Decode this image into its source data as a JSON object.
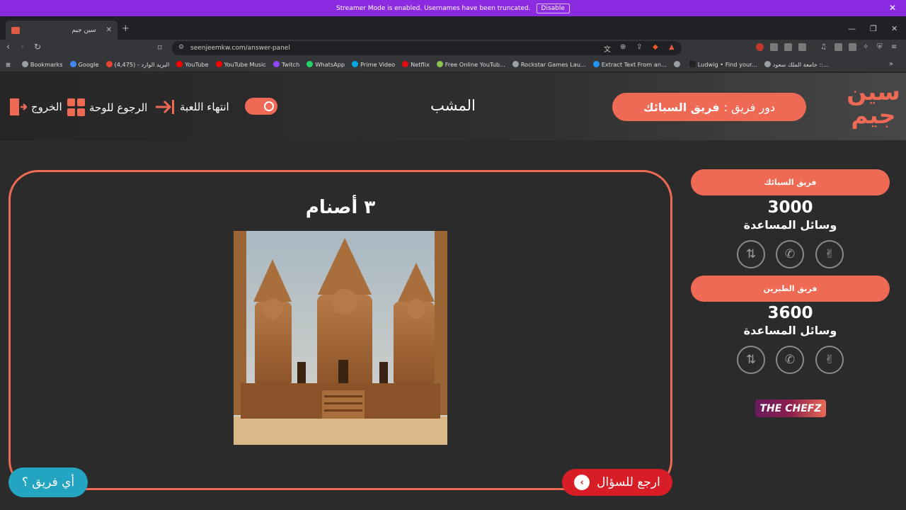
{
  "banner": {
    "message": "Streamer Mode is enabled. Usernames have been truncated.",
    "disable_label": "Disable"
  },
  "browser": {
    "tab_title": "سين جيم",
    "url": "seenjeemkw.com/answer-panel"
  },
  "bookmarks": [
    {
      "label": "Bookmarks",
      "color": "#9aa0a6"
    },
    {
      "label": "Google",
      "color": "#4285f4"
    },
    {
      "label": "البريد الوارد - (4,475)",
      "color": "#ea4335"
    },
    {
      "label": "YouTube",
      "color": "#ff0000"
    },
    {
      "label": "YouTube Music",
      "color": "#ff0000"
    },
    {
      "label": "Twitch",
      "color": "#9146ff"
    },
    {
      "label": "WhatsApp",
      "color": "#25d366"
    },
    {
      "label": "Prime Video",
      "color": "#00a8e1"
    },
    {
      "label": "Netflix",
      "color": "#e50914"
    },
    {
      "label": "Free Online YouTub...",
      "color": "#8bc34a"
    },
    {
      "label": "Rockstar Games Lau...",
      "color": "#9aa0a6"
    },
    {
      "label": "Extract Text From an...",
      "color": "#2196f3"
    },
    {
      "label": "",
      "color": "#9aa0a6"
    },
    {
      "label": "Ludwig • Find your...",
      "color": "#222222"
    },
    {
      "label": "جامعة الملك سعود ::...",
      "color": "#9aa0a6"
    }
  ],
  "header": {
    "exit_label": "الخروج",
    "board_label": "الرجوع للوحة",
    "end_game_label": "انتهاء اللعبة",
    "title": "المشب",
    "turn_prefix": "دور فريق :",
    "turn_team": "فريق السبائك",
    "logo_text": "سين جيم"
  },
  "question": {
    "title": "٣ أصنام"
  },
  "teams": [
    {
      "name": "فريق السبائك",
      "score": "3000",
      "helps_label": "وسائل المساعدة"
    },
    {
      "name": "فريق الطيرين",
      "score": "3600",
      "helps_label": "وسائل المساعدة"
    }
  ],
  "sponsor": {
    "label": "THE CHEFZ"
  },
  "footer": {
    "which_team_label": "أي فريق ؟",
    "back_to_question_label": "ارجع للسؤال"
  },
  "colors": {
    "accent": "#ef6a55",
    "back_button": "#d81d26",
    "which_team": "#23a4c0",
    "background": "#2b2b2b"
  }
}
